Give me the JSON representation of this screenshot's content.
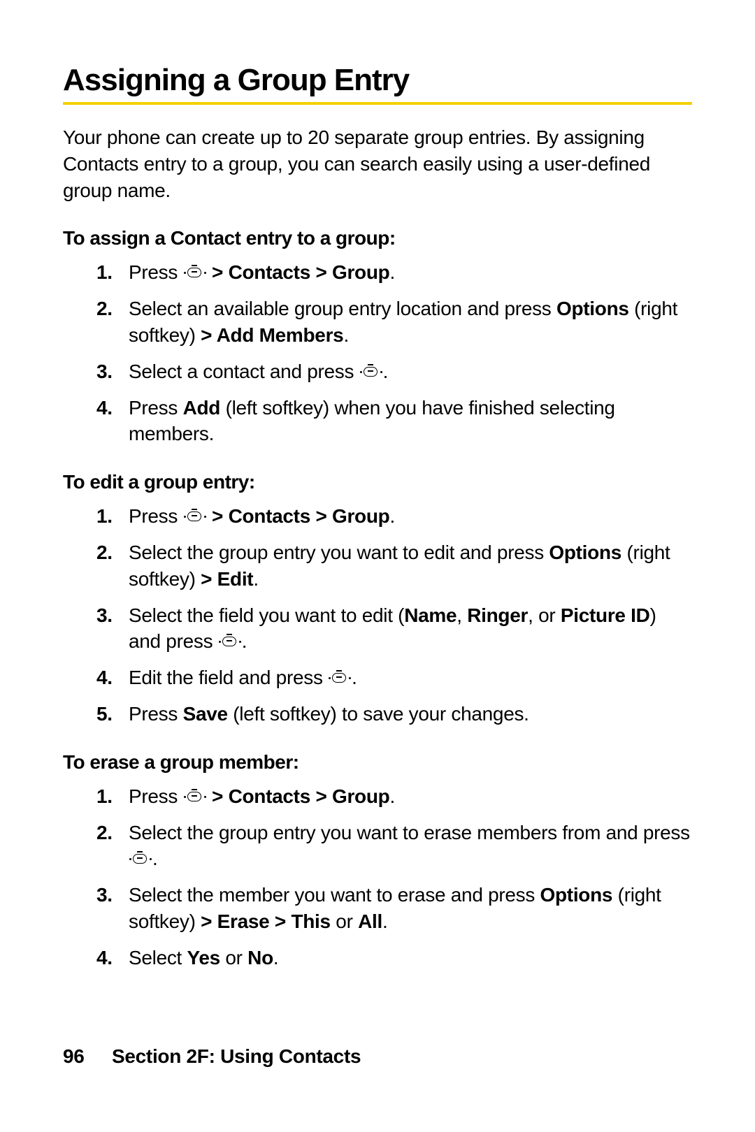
{
  "title": "Assigning a Group Entry",
  "intro": "Your phone can create up to 20 separate group entries. By assigning Contacts entry to a group, you can search easily using a user-defined group name.",
  "section1": {
    "heading": "To assign a Contact entry to a group:",
    "step1_a": "Press ",
    "step1_b": "> Contacts > Group",
    "step2_a": "Select an available group entry location and press ",
    "step2_b": "Options",
    "step2_c": " (right softkey) ",
    "step2_d": "> Add Members",
    "step3": "Select a contact and press ",
    "step4_a": "Press ",
    "step4_b": "Add",
    "step4_c": " (left softkey) when you have finished selecting members."
  },
  "section2": {
    "heading": "To edit a group entry:",
    "step1_a": "Press ",
    "step1_b": "> Contacts > Group",
    "step2_a": "Select the group entry you want to edit and press ",
    "step2_b": "Options",
    "step2_c": " (right softkey) ",
    "step2_d": "> Edit",
    "step3_a": "Select the field you want to edit (",
    "step3_b": "Name",
    "step3_c": ", ",
    "step3_d": "Ringer",
    "step3_e": ", or ",
    "step3_f": "Picture ID",
    "step3_g": ") and press ",
    "step4": "Edit the field and press ",
    "step5_a": "Press ",
    "step5_b": "Save",
    "step5_c": " (left softkey) to save your changes."
  },
  "section3": {
    "heading": "To erase a group member:",
    "step1_a": "Press ",
    "step1_b": "> Contacts > Group",
    "step2_a": "Select the group entry you want to erase members from and press ",
    "step3_a": "Select the member you want to erase and press ",
    "step3_b": "Options",
    "step3_c": " (right softkey) ",
    "step3_d": "> Erase > This",
    "step3_e": " or ",
    "step3_f": "All",
    "step4_a": "Select ",
    "step4_b": "Yes",
    "step4_c": " or ",
    "step4_d": "No"
  },
  "footer": {
    "page": "96",
    "section": "Section 2F: Using Contacts"
  }
}
